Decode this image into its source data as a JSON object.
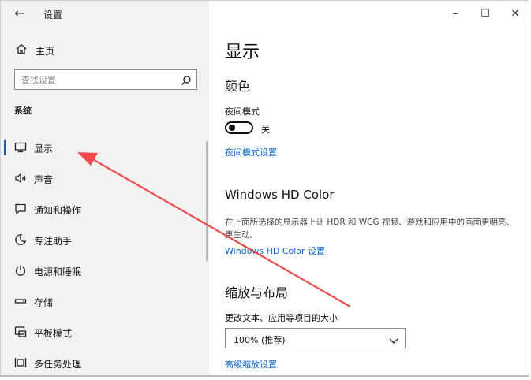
{
  "window": {
    "title": "设置",
    "controls": {
      "minimize": "–",
      "maximize": "☐",
      "close": "✕"
    }
  },
  "sidebar": {
    "home_label": "主页",
    "search_placeholder": "查找设置",
    "section_title": "系统",
    "items": [
      {
        "label": "显示",
        "icon": "monitor-icon",
        "selected": true
      },
      {
        "label": "声音",
        "icon": "speaker-icon"
      },
      {
        "label": "通知和操作",
        "icon": "notification-icon"
      },
      {
        "label": "专注助手",
        "icon": "moon-icon"
      },
      {
        "label": "电源和睡眠",
        "icon": "power-icon"
      },
      {
        "label": "存储",
        "icon": "storage-icon"
      },
      {
        "label": "平板模式",
        "icon": "tablet-mode-icon"
      },
      {
        "label": "多任务处理",
        "icon": "multitasking-icon"
      }
    ]
  },
  "main": {
    "page_title": "显示",
    "color_heading": "颜色",
    "night_mode_label": "夜间模式",
    "night_mode_state": "关",
    "night_mode_on": false,
    "night_mode_link": "夜间模式设置",
    "hdr_heading": "Windows HD Color",
    "hdr_desc": "在上面所选择的显示器上让 HDR 和 WCG 视频、游戏和应用中的画面更明亮、更生动。",
    "hdr_link": "Windows HD Color 设置",
    "scale_heading": "缩放与布局",
    "scale_label": "更改文本、应用等项目的大小",
    "scale_value": "100% (推荐)",
    "advanced_link": "高级缩放设置"
  },
  "colors": {
    "accent": "#0a64c8",
    "annotation_arrow": "#f04b4b",
    "sidebar_bg": "#f2f2f2"
  }
}
